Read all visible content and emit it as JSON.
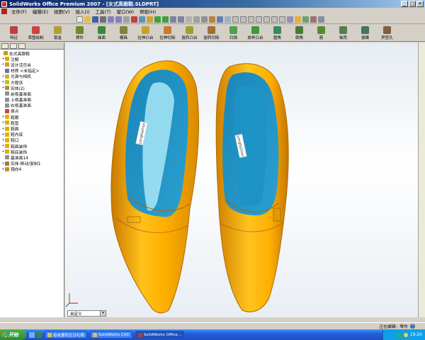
{
  "window": {
    "title": "SolidWorks Office Premium 2007 - [女式高跟鞋.SLDPRT]",
    "buttons": [
      "_",
      "□",
      "×"
    ]
  },
  "menu": [
    "文件(F)",
    "编辑(E)",
    "视图(V)",
    "插入(I)",
    "工具(T)",
    "窗口(W)",
    "帮助(H)"
  ],
  "features": [
    {
      "label": "特征",
      "icon_color": "#c04040",
      "icon": "feature-icon"
    },
    {
      "label": "草图绘制",
      "icon_color": "#d04040",
      "icon": "sketch-icon"
    },
    {
      "label": "钣金",
      "icon_color": "#b0a030",
      "icon": "sheetmetal-icon"
    },
    {
      "label": "焊件",
      "icon_color": "#6c8a2a",
      "icon": "weldment-icon"
    },
    {
      "label": "曲面",
      "icon_color": "#3a8a3a",
      "icon": "surface-icon"
    },
    {
      "label": "模具",
      "icon_color": "#808040",
      "icon": "mold-icon"
    },
    {
      "label": "拉伸凸台",
      "icon_color": "#c8a030",
      "icon": "extrude-boss-icon"
    },
    {
      "label": "拉伸切除",
      "icon_color": "#c87a30",
      "icon": "extrude-cut-icon"
    },
    {
      "label": "旋转凸台",
      "icon_color": "#a0a030",
      "icon": "revolve-boss-icon"
    },
    {
      "label": "旋转切除",
      "icon_color": "#a07030",
      "icon": "revolve-cut-icon"
    },
    {
      "label": "扫描",
      "icon_color": "#50a050",
      "icon": "sweep-icon"
    },
    {
      "label": "放样凸台",
      "icon_color": "#3c9a3c",
      "icon": "loft-icon"
    },
    {
      "label": "圆角",
      "icon_color": "#3a8a5a",
      "icon": "fillet-icon"
    },
    {
      "label": "倒角",
      "icon_color": "#4a7a3a",
      "icon": "chamfer-icon"
    },
    {
      "label": "筋",
      "icon_color": "#5a8a2a",
      "icon": "rib-icon"
    },
    {
      "label": "抽壳",
      "icon_color": "#508050",
      "icon": "shell-icon"
    },
    {
      "label": "拔模",
      "icon_color": "#4a7060",
      "icon": "draft-icon"
    },
    {
      "label": "异型孔",
      "icon_color": "#806040",
      "icon": "hole-icon"
    }
  ],
  "tree": {
    "items": [
      {
        "label": "女式高跟鞋",
        "exp": "",
        "icon_color": "#c0a000"
      },
      {
        "label": "注解",
        "exp": "+",
        "icon_color": "#d4b000"
      },
      {
        "label": "设计活页夹",
        "exp": "+",
        "icon_color": "#c0a030"
      },
      {
        "label": "材质 <未指定>",
        "exp": "",
        "icon_color": "#7070a0"
      },
      {
        "label": "光源与相机",
        "exp": "+",
        "icon_color": "#d0b030"
      },
      {
        "label": "方程序",
        "exp": "+",
        "icon_color": "#c0c020"
      },
      {
        "label": "实体(2)",
        "exp": "+",
        "icon_color": "#b09030"
      },
      {
        "label": "前视基准面",
        "exp": "",
        "icon_color": "#909090"
      },
      {
        "label": "上视基准面",
        "exp": "",
        "icon_color": "#909090"
      },
      {
        "label": "右视基准面",
        "exp": "",
        "icon_color": "#909090"
      },
      {
        "label": "原点",
        "exp": "",
        "icon_color": "#d04040"
      },
      {
        "label": "鞋跟",
        "exp": "+",
        "icon_color": "#e0b000"
      },
      {
        "label": "鞋垫",
        "exp": "+",
        "icon_color": "#e0b000"
      },
      {
        "label": "鞋面",
        "exp": "+",
        "icon_color": "#e0b000"
      },
      {
        "label": "鞋内底",
        "exp": "+",
        "icon_color": "#e0b000"
      },
      {
        "label": "鞋口",
        "exp": "+",
        "icon_color": "#e0b000"
      },
      {
        "label": "鞋面装饰",
        "exp": "+",
        "icon_color": "#e0b000"
      },
      {
        "label": "鞋底装饰",
        "exp": "+",
        "icon_color": "#e0b000"
      },
      {
        "label": "基准面14",
        "exp": "",
        "icon_color": "#909090"
      },
      {
        "label": "实体-移动/复制1",
        "exp": "+",
        "icon_color": "#a08030"
      },
      {
        "label": "镜向4",
        "exp": "+",
        "icon_color": "#c09030"
      }
    ]
  },
  "viewport": {
    "insole_label": "yangfashion",
    "view_select": "自定义"
  },
  "status": {
    "text": "正在编辑：零件"
  },
  "taskbar": {
    "start": "开始",
    "tasks": [
      "给老婆的生日礼物",
      "SolidWorks CAD",
      "SolidWorks Office..."
    ],
    "active_task": 2,
    "clock": "19:20"
  },
  "colors": {
    "shoe": "#f5a800",
    "lining": "#1b8fbf",
    "lining_light": "#9fe0f5"
  }
}
